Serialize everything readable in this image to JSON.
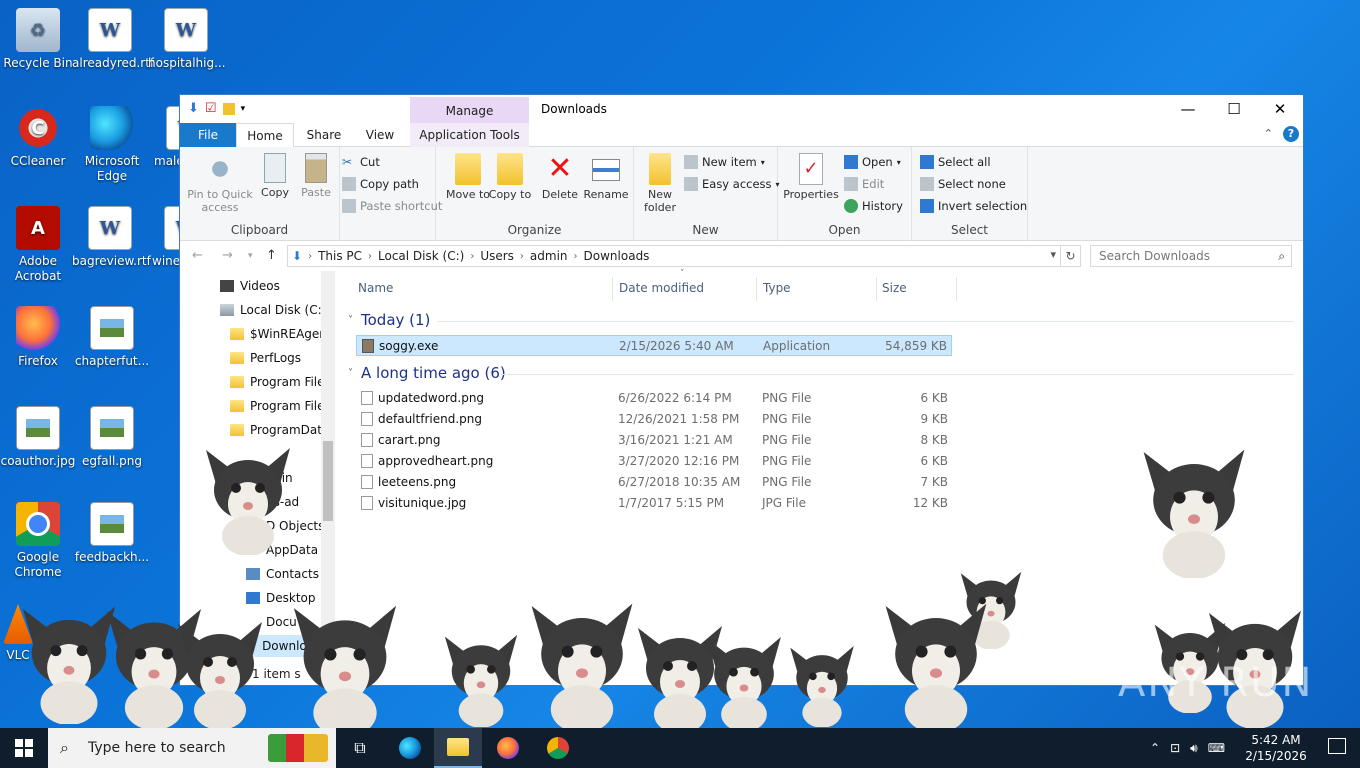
{
  "desktop": {
    "icons": [
      {
        "label": "Recycle Bin",
        "icon": "recycle-bin-icon"
      },
      {
        "label": "alreadyred.rtf",
        "icon": "word-document-icon"
      },
      {
        "label": "hospitalhig...",
        "icon": "word-document-icon"
      },
      {
        "label": "CCleaner",
        "icon": "ccleaner-icon"
      },
      {
        "label": "Microsoft Edge",
        "icon": "edge-icon"
      },
      {
        "label": "male",
        "icon": "word-document-icon"
      },
      {
        "label": "Adobe Acrobat",
        "icon": "acrobat-icon"
      },
      {
        "label": "bagreview.rtf",
        "icon": "word-document-icon"
      },
      {
        "label": "wine",
        "icon": "word-document-icon"
      },
      {
        "label": "Firefox",
        "icon": "firefox-icon"
      },
      {
        "label": "chapterfut...",
        "icon": "image-file-icon"
      },
      {
        "label": "coauthor.jpg",
        "icon": "image-file-icon"
      },
      {
        "label": "egfall.png",
        "icon": "image-file-icon"
      },
      {
        "label": "Google Chrome",
        "icon": "chrome-icon"
      },
      {
        "label": "feedbackh...",
        "icon": "image-file-icon"
      },
      {
        "label": "VLC",
        "icon": "vlc-icon"
      }
    ]
  },
  "window": {
    "title": "Downloads",
    "manage_label": "Manage",
    "controls": {
      "minimize": "—",
      "maximize": "☐",
      "close": "✕"
    }
  },
  "tabs": {
    "file": "File",
    "home": "Home",
    "share": "Share",
    "view": "View",
    "app_tools": "Application Tools"
  },
  "ribbon": {
    "clipboard": {
      "label": "Clipboard",
      "pin": "Pin to Quick access",
      "copy": "Copy",
      "paste": "Paste",
      "cut": "Cut",
      "copy_path": "Copy path",
      "paste_shortcut": "Paste shortcut"
    },
    "organize": {
      "label": "Organize",
      "move_to": "Move to",
      "copy_to": "Copy to",
      "delete": "Delete",
      "rename": "Rename"
    },
    "new": {
      "label": "New",
      "new_folder": "New folder",
      "new_item": "New item",
      "easy_access": "Easy access"
    },
    "open": {
      "label": "Open",
      "properties": "Properties",
      "open": "Open",
      "edit": "Edit",
      "history": "History"
    },
    "select": {
      "label": "Select",
      "select_all": "Select all",
      "select_none": "Select none",
      "invert": "Invert selection"
    }
  },
  "address": {
    "segments": [
      "This PC",
      "Local Disk (C:)",
      "Users",
      "admin",
      "Downloads"
    ],
    "search_placeholder": "Search Downloads"
  },
  "nav_pane": {
    "items": [
      {
        "label": "Videos",
        "icon": "videos-icon"
      },
      {
        "label": "Local Disk (C:)",
        "icon": "drive-icon"
      },
      {
        "label": "$WinREAgent",
        "icon": "folder-icon"
      },
      {
        "label": "PerfLogs",
        "icon": "folder-icon"
      },
      {
        "label": "Program Files",
        "icon": "folder-icon"
      },
      {
        "label": "Program Files",
        "icon": "folder-icon"
      },
      {
        "label": "ProgramData",
        "icon": "folder-icon"
      },
      {
        "label": "min",
        "icon": "folder-icon"
      },
      {
        "label": "ns-ad",
        "icon": "folder-icon"
      },
      {
        "label": "D Objects",
        "icon": "folder-icon"
      },
      {
        "label": "AppData",
        "icon": "folder-icon"
      },
      {
        "label": "Contacts",
        "icon": "contacts-icon"
      },
      {
        "label": "Desktop",
        "icon": "desktop-icon"
      },
      {
        "label": "Docu",
        "icon": "documents-icon"
      },
      {
        "label": "Downlo",
        "icon": "downloads-icon"
      }
    ]
  },
  "columns": {
    "name": "Name",
    "date": "Date modified",
    "type": "Type",
    "size": "Size"
  },
  "groups": [
    {
      "title": "Today (1)",
      "files": [
        {
          "name": "soggy.exe",
          "date": "2/15/2026 5:40 AM",
          "type": "Application",
          "size": "54,859 KB",
          "selected": true
        }
      ]
    },
    {
      "title": "A long time ago (6)",
      "files": [
        {
          "name": "updatedword.png",
          "date": "6/26/2022 6:14 PM",
          "type": "PNG File",
          "size": "6 KB"
        },
        {
          "name": "defaultfriend.png",
          "date": "12/26/2021 1:58 PM",
          "type": "PNG File",
          "size": "9 KB"
        },
        {
          "name": "carart.png",
          "date": "3/16/2021 1:21 AM",
          "type": "PNG File",
          "size": "8 KB"
        },
        {
          "name": "approvedheart.png",
          "date": "3/27/2020 12:16 PM",
          "type": "PNG File",
          "size": "6 KB"
        },
        {
          "name": "leeteens.png",
          "date": "6/27/2018 10:35 AM",
          "type": "PNG File",
          "size": "7 KB"
        },
        {
          "name": "visitunique.jpg",
          "date": "1/7/2017 5:15 PM",
          "type": "JPG File",
          "size": "12 KB"
        }
      ]
    }
  ],
  "status": {
    "text": "1 item s",
    "tail": "B"
  },
  "watermark": "ANY RUN",
  "taskbar": {
    "search_placeholder": "Type here to search",
    "time": "5:42 AM",
    "date": "2/15/2026"
  }
}
